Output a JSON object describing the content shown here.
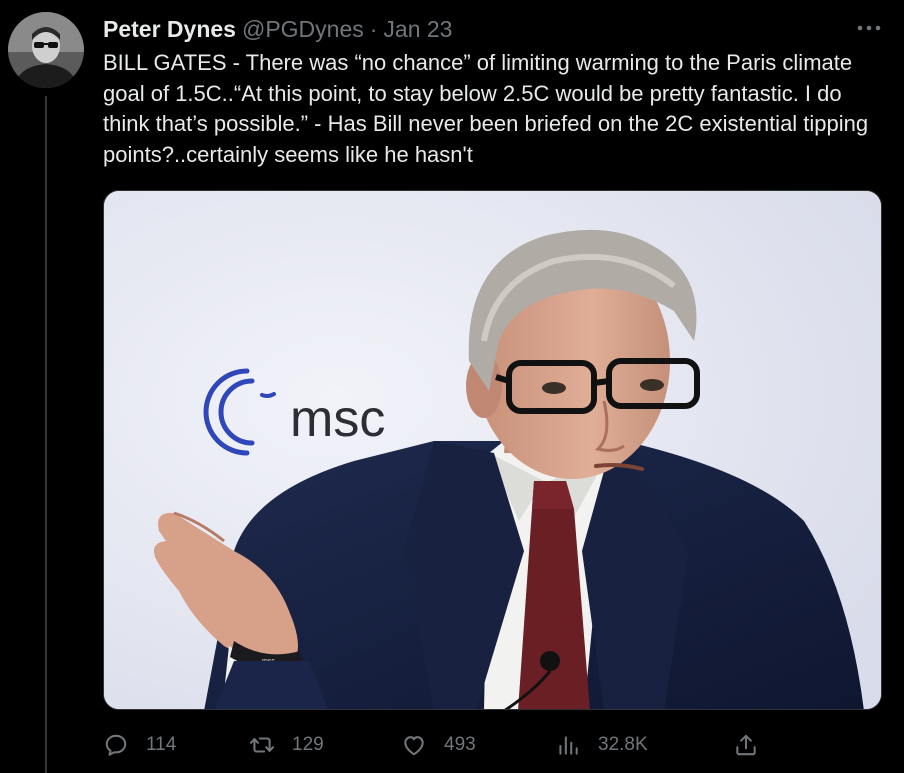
{
  "tweet": {
    "author": {
      "display_name": "Peter Dynes",
      "handle": "@PGDynes",
      "avatar_icon": "user-avatar"
    },
    "separator": "·",
    "date": "Jan 23",
    "text": "BILL GATES - There was “no chance” of limiting warming to the Paris climate goal of 1.5C..“At this point, to stay below 2.5C would be pretty fantastic. I do think that’s possible.” - Has Bill never been briefed on the 2C existential tipping points?..certainly seems like he hasn't",
    "media": {
      "logo_text": "msc",
      "wristband_text": "msc"
    },
    "actions": {
      "replies": "114",
      "retweets": "129",
      "likes": "493",
      "views": "32.8K"
    },
    "icons": {
      "more": "more-icon",
      "reply": "reply-icon",
      "retweet": "retweet-icon",
      "like": "heart-icon",
      "views": "views-icon",
      "share": "share-icon"
    }
  },
  "colors": {
    "background": "#000000",
    "text_primary": "#e7e9ea",
    "text_secondary": "#71767b",
    "thread_line": "#333639",
    "msc_logo_blue": "#2f47b8"
  }
}
